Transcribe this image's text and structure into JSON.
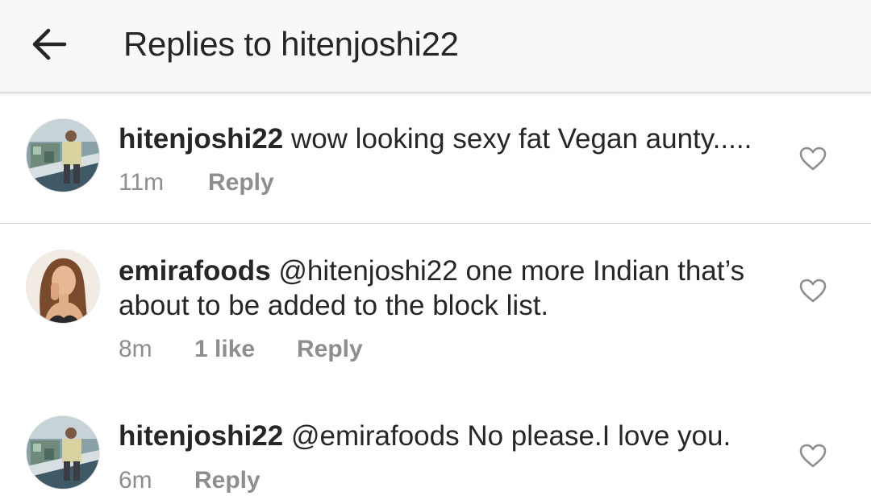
{
  "header": {
    "title": "Replies to hitenjoshi22",
    "back_icon": "arrow-left-icon"
  },
  "comments": [
    {
      "username": "hitenjoshi22",
      "text": " wow looking sexy fat Vegan aunty.....",
      "time": "11m",
      "likes": "",
      "reply_label": "Reply",
      "like_icon": "heart-outline-icon"
    },
    {
      "username": "emirafoods",
      "text": " @hitenjoshi22 one more Indian that’s about to be added to the block list.",
      "time": "8m",
      "likes": "1 like",
      "reply_label": "Reply",
      "like_icon": "heart-outline-icon"
    },
    {
      "username": "hitenjoshi22",
      "text": " @emirafoods No please.I love you.",
      "time": "6m",
      "likes": "",
      "reply_label": "Reply",
      "like_icon": "heart-outline-icon"
    }
  ]
}
